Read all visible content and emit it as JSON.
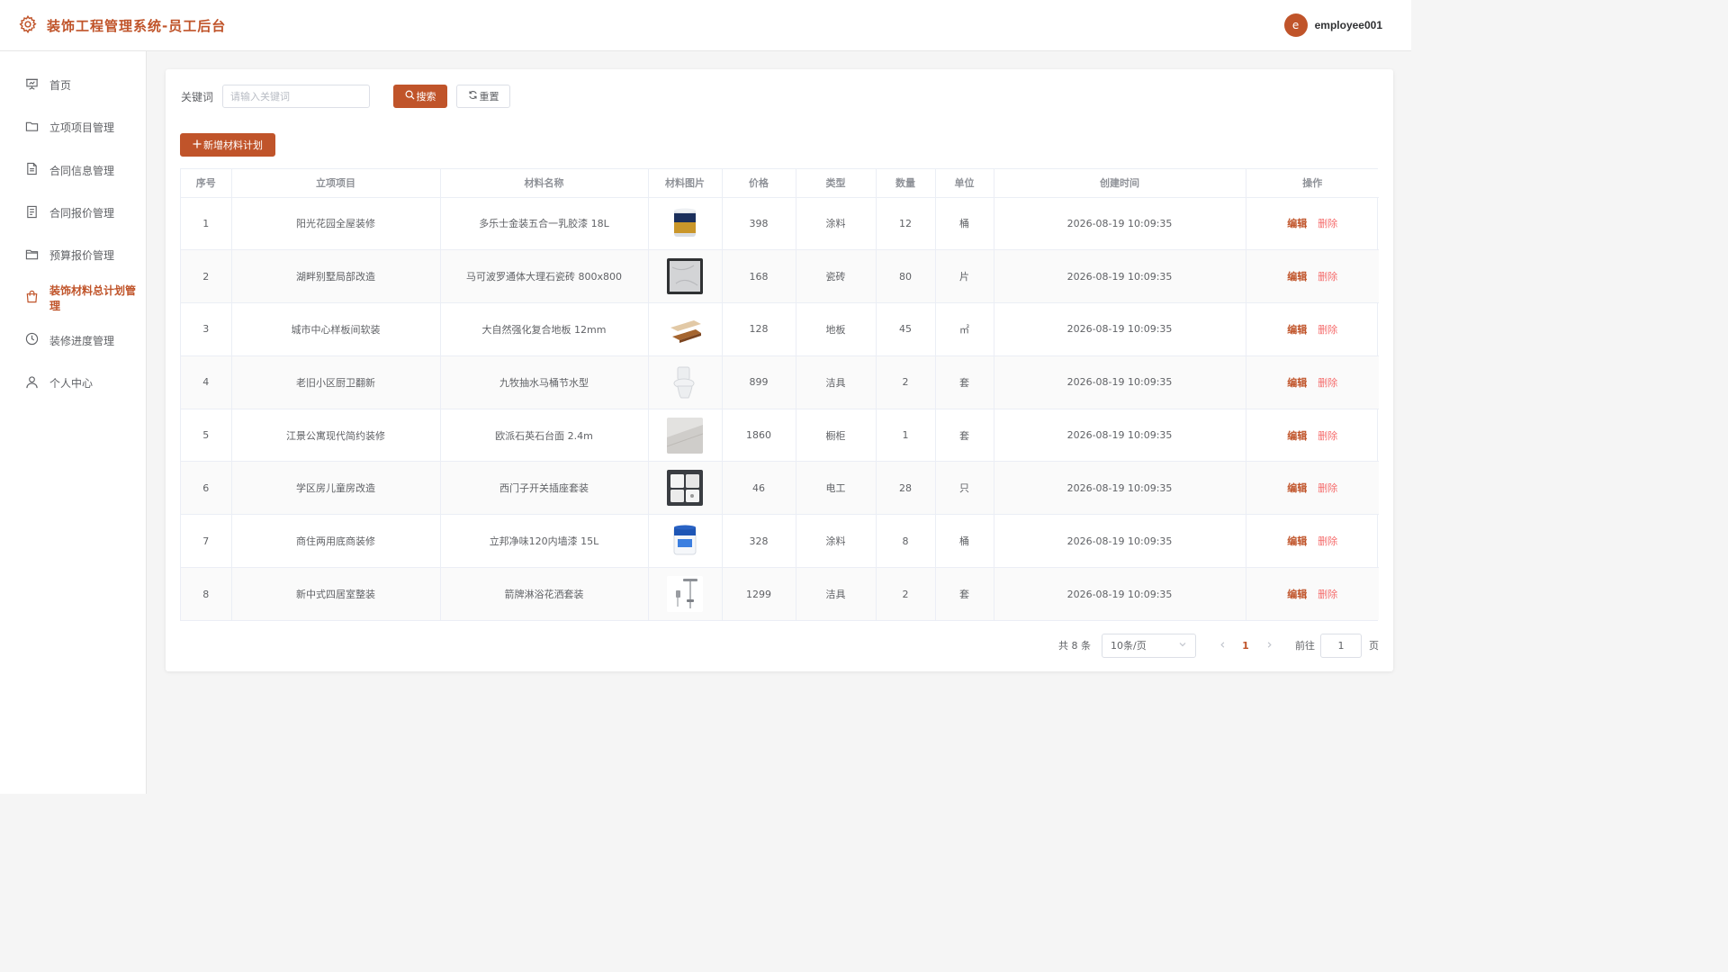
{
  "header": {
    "title": "装饰工程管理系统-员工后台",
    "avatar_letter": "e",
    "username": "employee001",
    "brand_color": "#c0542a"
  },
  "sidebar": {
    "items": [
      {
        "label": "首页",
        "icon": "presentation-icon"
      },
      {
        "label": "立项项目管理",
        "icon": "folder-icon"
      },
      {
        "label": "合同信息管理",
        "icon": "document-icon"
      },
      {
        "label": "合同报价管理",
        "icon": "document-list-icon"
      },
      {
        "label": "预算报价管理",
        "icon": "folder-open-icon"
      },
      {
        "label": "装饰材料总计划管理",
        "icon": "shopping-bag-icon",
        "active": true
      },
      {
        "label": "装修进度管理",
        "icon": "clock-icon"
      },
      {
        "label": "个人中心",
        "icon": "user-icon"
      }
    ]
  },
  "search": {
    "label": "关键词",
    "placeholder": "请输入关键词",
    "search_button": "搜索",
    "reset_button": "重置"
  },
  "add_button": "新增材料计划",
  "table": {
    "columns": [
      "序号",
      "立项项目",
      "材料名称",
      "材料图片",
      "价格",
      "类型",
      "数量",
      "单位",
      "创建时间",
      "操作"
    ],
    "edit_label": "编辑",
    "delete_label": "删除",
    "rows": [
      {
        "index": "1",
        "project": "阳光花园全屋装修",
        "material": "多乐士金装五合一乳胶漆 18L",
        "image": "paint-bucket-gold",
        "price": "398",
        "type": "涂料",
        "quantity": "12",
        "unit": "桶",
        "created": "2026-08-19 10:09:35"
      },
      {
        "index": "2",
        "project": "湖畔别墅局部改造",
        "material": "马可波罗通体大理石瓷砖 800x800",
        "image": "marble-tile",
        "price": "168",
        "type": "瓷砖",
        "quantity": "80",
        "unit": "片",
        "created": "2026-08-19 10:09:35"
      },
      {
        "index": "3",
        "project": "城市中心样板间软装",
        "material": "大自然强化复合地板 12mm",
        "image": "wood-floor",
        "price": "128",
        "type": "地板",
        "quantity": "45",
        "unit": "㎡",
        "created": "2026-08-19 10:09:35"
      },
      {
        "index": "4",
        "project": "老旧小区厨卫翻新",
        "material": "九牧抽水马桶节水型",
        "image": "toilet",
        "price": "899",
        "type": "洁具",
        "quantity": "2",
        "unit": "套",
        "created": "2026-08-19 10:09:35"
      },
      {
        "index": "5",
        "project": "江景公寓现代简约装修",
        "material": "欧派石英石台面 2.4m",
        "image": "quartz-counter",
        "price": "1860",
        "type": "橱柜",
        "quantity": "1",
        "unit": "套",
        "created": "2026-08-19 10:09:35"
      },
      {
        "index": "6",
        "project": "学区房儿童房改造",
        "material": "西门子开关插座套装",
        "image": "switch-socket-set",
        "price": "46",
        "type": "电工",
        "quantity": "28",
        "unit": "只",
        "created": "2026-08-19 10:09:35"
      },
      {
        "index": "7",
        "project": "商住两用底商装修",
        "material": "立邦净味120内墙漆 15L",
        "image": "paint-bucket-blue",
        "price": "328",
        "type": "涂料",
        "quantity": "8",
        "unit": "桶",
        "created": "2026-08-19 10:09:35"
      },
      {
        "index": "8",
        "project": "新中式四居室整装",
        "material": "箭牌淋浴花洒套装",
        "image": "shower-set",
        "price": "1299",
        "type": "洁具",
        "quantity": "2",
        "unit": "套",
        "created": "2026-08-19 10:09:35"
      }
    ]
  },
  "pagination": {
    "total": "共 8 条",
    "page_size": "10条/页",
    "current_page": "1",
    "goto_label": "前往",
    "goto_value": "1",
    "unit": "页"
  }
}
